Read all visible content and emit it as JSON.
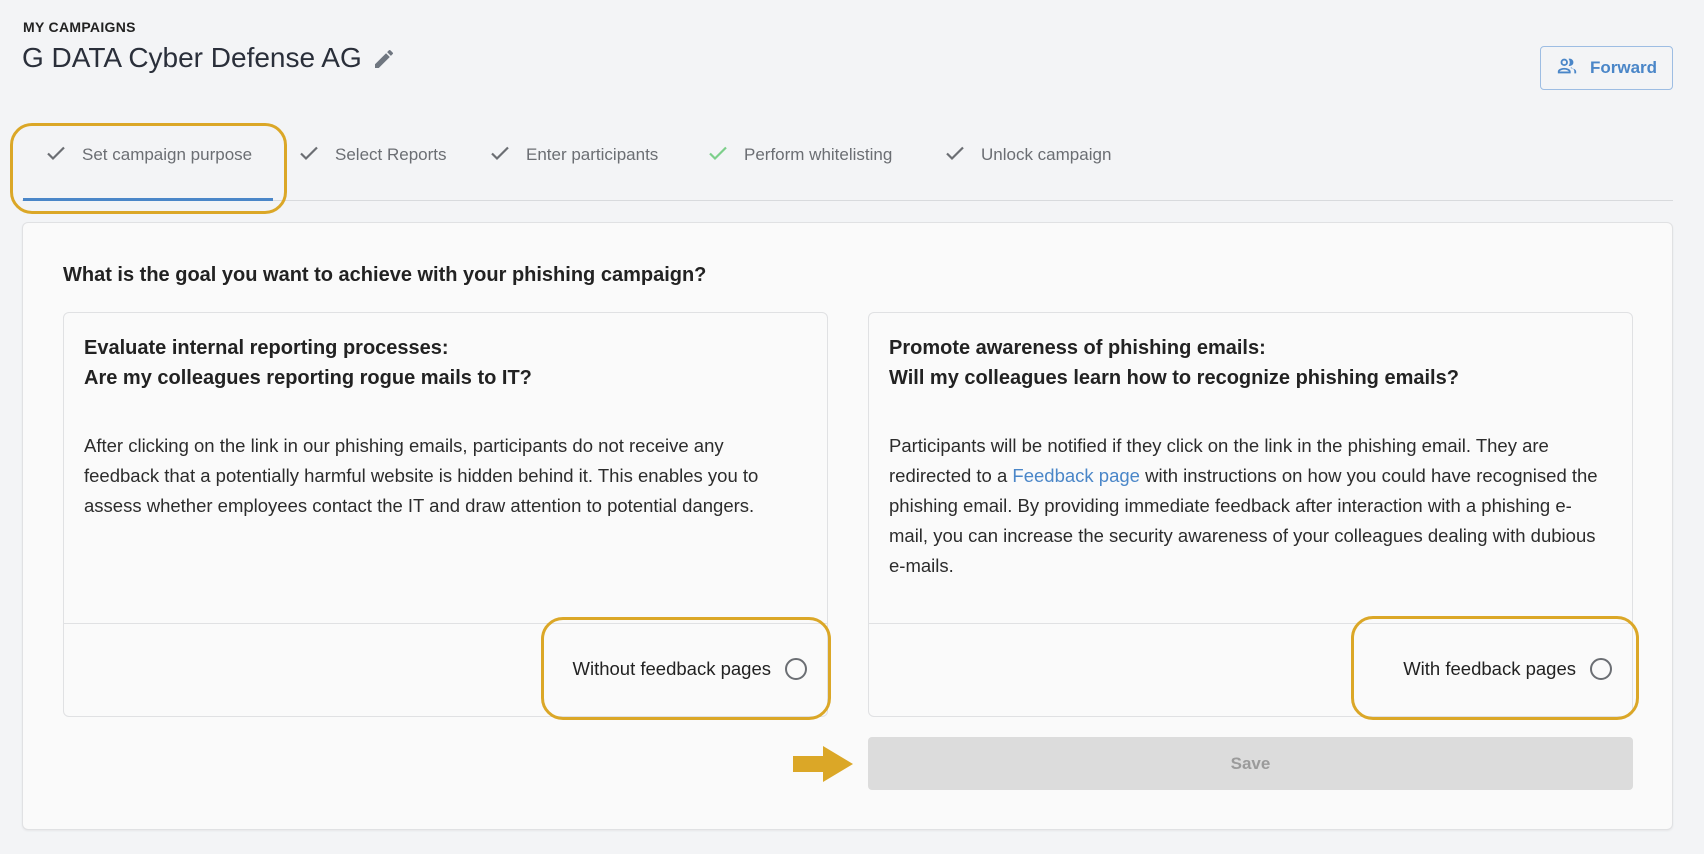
{
  "header": {
    "overline": "MY CAMPAIGNS",
    "title": "G DATA Cyber Defense AG",
    "edit_icon": "pencil-icon",
    "forward_button": {
      "label": "Forward",
      "icon": "users-icon"
    }
  },
  "tabs": [
    {
      "label": "Set campaign purpose",
      "icon": "check-icon",
      "active": true,
      "check_color": "#6b6e73"
    },
    {
      "label": "Select Reports",
      "icon": "check-icon",
      "active": false,
      "check_color": "#6b6e73"
    },
    {
      "label": "Enter participants",
      "icon": "check-icon",
      "active": false,
      "check_color": "#6b6e73"
    },
    {
      "label": "Perform whitelisting",
      "icon": "check-icon",
      "active": false,
      "check_color": "#7ccf8a"
    },
    {
      "label": "Unlock campaign",
      "icon": "check-icon",
      "active": false,
      "check_color": "#6b6e73"
    }
  ],
  "main": {
    "question": "What is the goal you want to achieve with your phishing campaign?",
    "options": [
      {
        "heading_line1": "Evaluate internal reporting processes:",
        "heading_line2": "Are my colleagues reporting rogue mails to IT?",
        "body": "After clicking on the link in our phishing emails, participants do not receive any feedback that a potentially harmful website is hidden behind it. This enables you to assess whether employees contact the IT and draw attention to potential dangers.",
        "radio_label": "Without feedback pages",
        "selected": false
      },
      {
        "heading_line1": "Promote awareness of phishing emails:",
        "heading_line2": "Will my colleagues learn how to recognize phishing emails?",
        "body_before_link": "Participants will be notified if they click on the link in the phishing email. They are redirected to a ",
        "body_link": "Feedback page",
        "body_after_link": " with instructions on how you could have recognised the phishing email. By providing immediate feedback after interaction with a phishing e-mail, you can increase the security awareness of your colleagues dealing with dubious e-mails.",
        "radio_label": "With feedback pages",
        "selected": false
      }
    ],
    "save_button": {
      "label": "Save",
      "disabled": true
    }
  },
  "colors": {
    "accent": "#4a86c8",
    "highlight": "#dba727",
    "success_check": "#7ccf8a",
    "disabled_bg": "#dcdcdc"
  }
}
